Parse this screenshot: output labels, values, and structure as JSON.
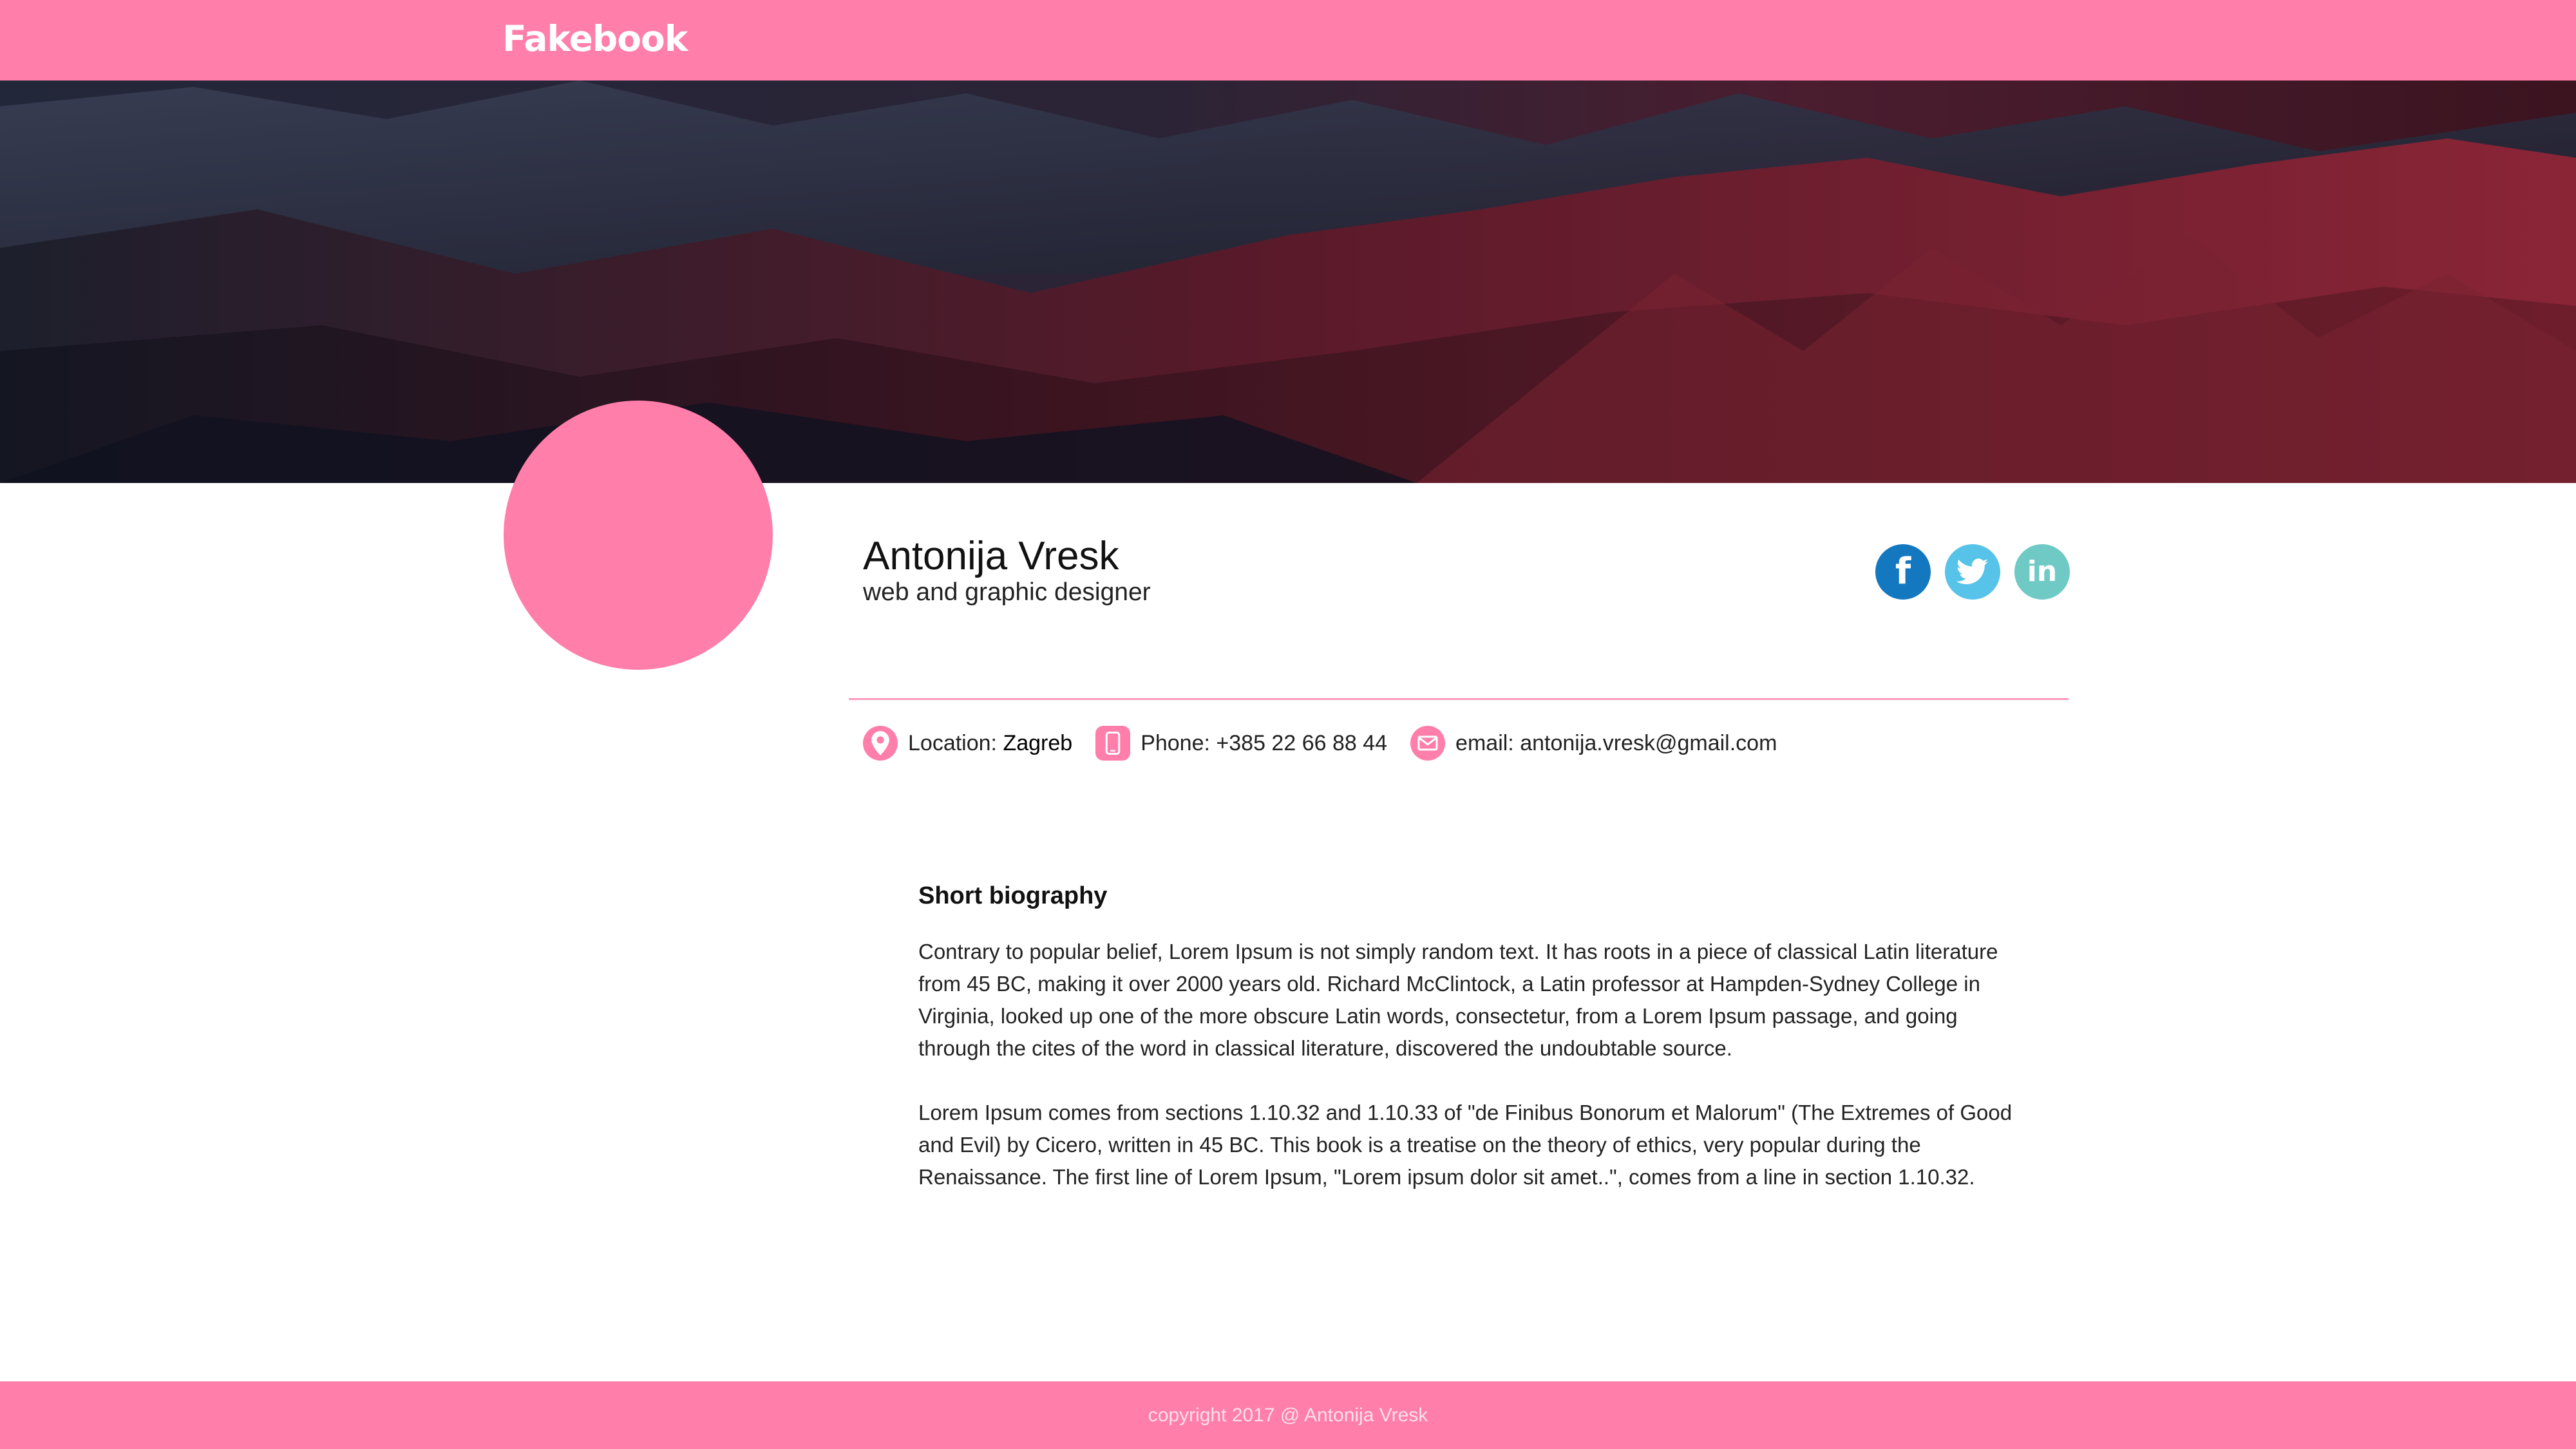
{
  "header": {
    "logo": "Fakebook"
  },
  "profile": {
    "name": "Antonija Vresk",
    "title": "web and graphic designer",
    "cover_description": "mountain range",
    "social": [
      {
        "name": "facebook",
        "icon": "facebook-icon",
        "glyph": "f",
        "color": "#1478c1"
      },
      {
        "name": "twitter",
        "icon": "twitter-icon",
        "glyph": "",
        "color": "#58c3e8"
      },
      {
        "name": "linkedin",
        "icon": "linkedin-icon",
        "glyph": "in",
        "color": "#6fc9c5"
      }
    ]
  },
  "contact": {
    "location_label": "Location:",
    "location_value": "Zagreb",
    "phone": "Phone: +385 22 66 88 44",
    "email": "email: antonija.vresk@gmail.com"
  },
  "bio": {
    "heading": "Short biography",
    "paragraphs": [
      "Contrary to popular belief, Lorem Ipsum is not simply random text. It has roots in a piece of classical Latin literature from 45 BC, making it over 2000 years old. Richard McClintock, a Latin professor at Hampden-Sydney College in Virginia, looked up one of the more obscure Latin words, consectetur, from a Lorem Ipsum passage, and going through the cites of the word in classical literature, discovered the undoubtable source.",
      "Lorem Ipsum comes from sections 1.10.32 and 1.10.33 of \"de Finibus Bonorum et Malorum\" (The Extremes of Good and Evil) by Cicero, written in 45 BC. This book is a treatise on the theory of ethics, very popular during the Renaissance. The first line of Lorem Ipsum, \"Lorem ipsum dolor sit amet..\", comes from a line in section 1.10.32."
    ]
  },
  "footer": {
    "copyright": "copyright 2017 @ Antonija Vresk"
  },
  "colors": {
    "brand_pink": "#ff7eaa",
    "divider_pink": "#ff9bbd",
    "facebook": "#1478c1",
    "twitter": "#58c3e8",
    "linkedin": "#6fc9c5"
  }
}
